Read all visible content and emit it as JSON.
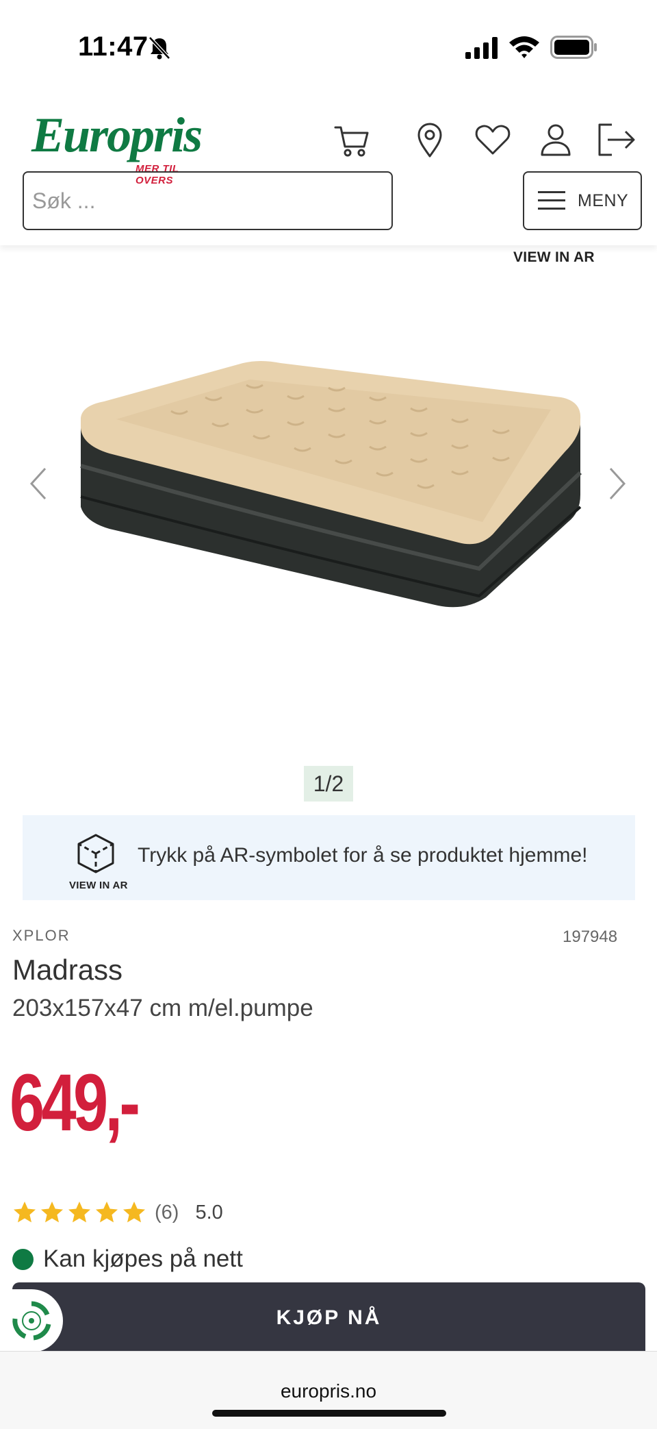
{
  "status_bar": {
    "time": "11:47"
  },
  "header": {
    "logo_text": "Europris",
    "logo_tagline": "MER TIL OVERS",
    "icons": [
      "cart-icon",
      "location-icon",
      "heart-icon",
      "user-icon",
      "logout-icon"
    ],
    "search_placeholder": "Søk ...",
    "menu_label": "MENY"
  },
  "gallery": {
    "view_in_ar": "VIEW IN AR",
    "pager": "1/2"
  },
  "ar_banner": {
    "cube_label": "VIEW IN AR",
    "text": "Trykk på AR-symbolet for å se produktet hjemme!"
  },
  "product": {
    "brand": "XPLOR",
    "sku": "197948",
    "name": "Madrass",
    "description": "203x157x47 cm m/el.pumpe",
    "price": "649,-",
    "rating_count": "(6)",
    "rating_score": "5.0",
    "rating_stars": 5,
    "availability": "Kan kjøpes på nett",
    "buy_label": "KJØP NÅ"
  },
  "browser": {
    "url": "europris.no"
  },
  "colors": {
    "brand_green": "#0f7a43",
    "price_red": "#d21f3c",
    "button_dark": "#353641",
    "star_yellow": "#f5b820"
  }
}
